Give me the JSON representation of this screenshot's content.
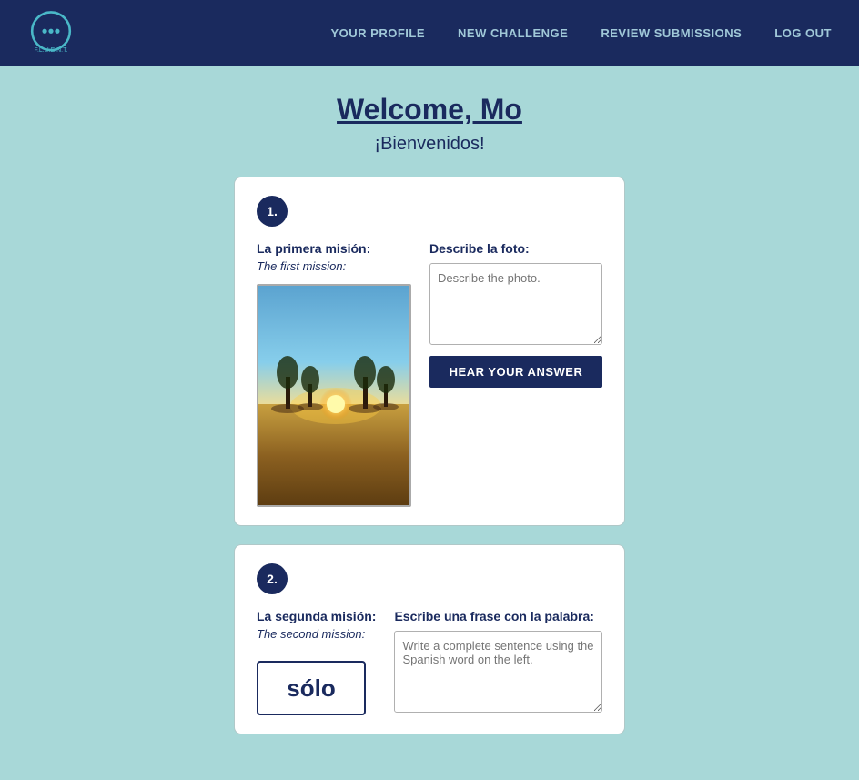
{
  "nav": {
    "logo_text": "F.L.U.E.N.T.",
    "links": [
      {
        "label": "YOUR PROFILE",
        "name": "nav-your-profile"
      },
      {
        "label": "NEW CHALLENGE",
        "name": "nav-new-challenge"
      },
      {
        "label": "REVIEW SUBMISSIONS",
        "name": "nav-review-submissions"
      },
      {
        "label": "LOG OUT",
        "name": "nav-log-out"
      }
    ]
  },
  "header": {
    "welcome": "Welcome, Mo",
    "bienvenidos": "¡Bienvenidos!"
  },
  "missions": [
    {
      "number": "1.",
      "title_es": "La primera misión:",
      "title_en": "The first mission:",
      "label_right": "Describe la foto:",
      "textarea_placeholder": "Describe the photo.",
      "button_label": "HEAR YOUR ANSWER"
    },
    {
      "number": "2.",
      "title_es": "La segunda misión:",
      "title_en": "The second mission:",
      "label_right": "Escribe una frase con la palabra:",
      "spanish_word": "sólo",
      "textarea_placeholder": "Write a complete sentence using the Spanish word on the left."
    }
  ]
}
